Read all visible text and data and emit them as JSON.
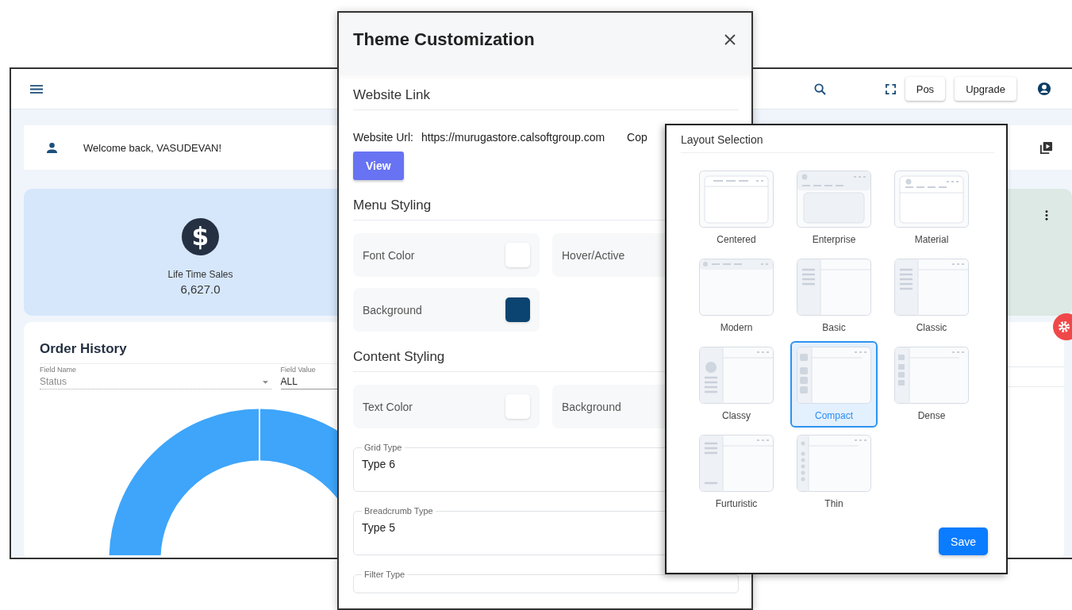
{
  "app": {
    "topbar_buttons": [
      "Pos",
      "Upgrade"
    ],
    "welcome": "Welcome back, VASUDEVAN!",
    "sales_card": {
      "icon": "$",
      "label": "Life Time Sales",
      "value": "6,627.0"
    },
    "order_history": {
      "title": "Order History",
      "filters": [
        {
          "label": "Field Name",
          "value": "Status",
          "disabled": true
        },
        {
          "label": "Field Value",
          "value": "ALL",
          "disabled": false
        }
      ]
    }
  },
  "dialog": {
    "title": "Theme Customization",
    "website_link": {
      "heading": "Website Link",
      "url_label": "Website Url:",
      "url": "https://murugastore.calsoftgroup.com",
      "cut_text": "Cop",
      "button": "View"
    },
    "menu_styling": {
      "heading": "Menu Styling",
      "swatches": [
        {
          "label": "Font Color",
          "color": "#ffffff"
        },
        {
          "label": "Hover/Active"
        },
        {
          "label": "Background",
          "color": "#0b4470"
        }
      ]
    },
    "content_styling": {
      "heading": "Content Styling",
      "swatches": [
        {
          "label": "Text Color",
          "color": "#ffffff"
        },
        {
          "label": "Background"
        }
      ],
      "fields": [
        {
          "label": "Grid Type",
          "value": "Type 6"
        },
        {
          "label": "Breadcrumb Type",
          "value": "Type 5"
        },
        {
          "label": "Filter Type"
        }
      ]
    }
  },
  "layout_panel": {
    "title": "Layout Selection",
    "save": "Save",
    "layouts": [
      {
        "label": "Centered",
        "kind": "centered",
        "selected": false
      },
      {
        "label": "Enterprise",
        "kind": "enterprise",
        "selected": false
      },
      {
        "label": "Material",
        "kind": "material",
        "selected": false
      },
      {
        "label": "Modern",
        "kind": "modern",
        "selected": false
      },
      {
        "label": "Basic",
        "kind": "basic",
        "selected": false
      },
      {
        "label": "Classic",
        "kind": "classic",
        "selected": false
      },
      {
        "label": "Classy",
        "kind": "classy",
        "selected": false
      },
      {
        "label": "Compact",
        "kind": "compact",
        "selected": true
      },
      {
        "label": "Dense",
        "kind": "dense",
        "selected": false
      },
      {
        "label": "Furturistic",
        "kind": "furturistic",
        "selected": false
      },
      {
        "label": "Thin",
        "kind": "thin",
        "selected": false
      }
    ]
  }
}
